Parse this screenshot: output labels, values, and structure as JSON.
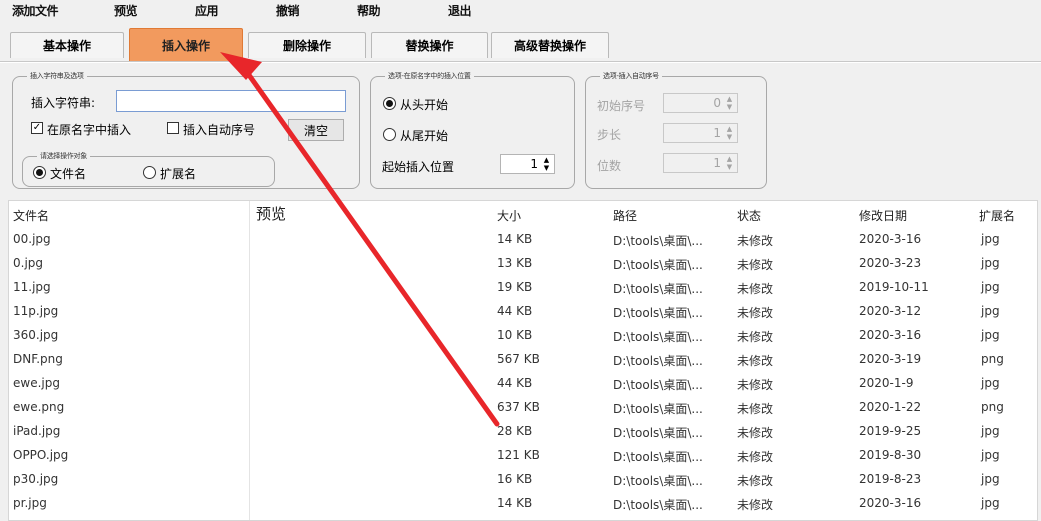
{
  "menu": [
    "添加文件",
    "预览",
    "应用",
    "撤销",
    "帮助",
    "退出"
  ],
  "tabs": [
    {
      "label": "基本操作",
      "active": false
    },
    {
      "label": "插入操作",
      "active": true
    },
    {
      "label": "删除操作",
      "active": false
    },
    {
      "label": "替换操作",
      "active": false
    },
    {
      "label": "高级替换操作",
      "active": false
    }
  ],
  "insert_group": {
    "legend": "插入字符串及选项",
    "string_label": "插入字符串:",
    "string_value": "",
    "in_original_label": "在原名字中插入",
    "in_original_checked": true,
    "auto_number_label": "插入自动序号",
    "auto_number_checked": false,
    "clear_label": "清空"
  },
  "target_group": {
    "legend": "请选择操作对象",
    "filename_label": "文件名",
    "filename_selected": true,
    "extension_label": "扩展名",
    "extension_selected": false
  },
  "position_group": {
    "legend": "选项-在原名字中的插入位置",
    "from_start_label": "从头开始",
    "from_start_selected": true,
    "from_end_label": "从尾开始",
    "from_end_selected": false,
    "start_pos_label": "起始插入位置",
    "start_pos_value": "1"
  },
  "number_group": {
    "legend": "选项-插入自动序号",
    "initial_label": "初始序号",
    "initial_value": "0",
    "step_label": "步长",
    "step_value": "1",
    "digits_label": "位数",
    "digits_value": "1"
  },
  "table": {
    "headers": [
      "文件名",
      "预览",
      "大小",
      "路径",
      "状态",
      "修改日期",
      "扩展名"
    ],
    "rows": [
      [
        "00.jpg",
        "",
        "14 KB",
        "D:\\tools\\桌面\\...",
        "未修改",
        "2020-3-16",
        "jpg"
      ],
      [
        "0.jpg",
        "",
        "13 KB",
        "D:\\tools\\桌面\\...",
        "未修改",
        "2020-3-23",
        "jpg"
      ],
      [
        "11.jpg",
        "",
        "19 KB",
        "D:\\tools\\桌面\\...",
        "未修改",
        "2019-10-11",
        "jpg"
      ],
      [
        "11p.jpg",
        "",
        "44 KB",
        "D:\\tools\\桌面\\...",
        "未修改",
        "2020-3-12",
        "jpg"
      ],
      [
        "360.jpg",
        "",
        "10 KB",
        "D:\\tools\\桌面\\...",
        "未修改",
        "2020-3-16",
        "jpg"
      ],
      [
        "DNF.png",
        "",
        "567 KB",
        "D:\\tools\\桌面\\...",
        "未修改",
        "2020-3-19",
        "png"
      ],
      [
        "ewe.jpg",
        "",
        "44 KB",
        "D:\\tools\\桌面\\...",
        "未修改",
        "2020-1-9",
        "jpg"
      ],
      [
        "ewe.png",
        "",
        "637 KB",
        "D:\\tools\\桌面\\...",
        "未修改",
        "2020-1-22",
        "png"
      ],
      [
        "iPad.jpg",
        "",
        "28 KB",
        "D:\\tools\\桌面\\...",
        "未修改",
        "2019-9-25",
        "jpg"
      ],
      [
        "OPPO.jpg",
        "",
        "121 KB",
        "D:\\tools\\桌面\\...",
        "未修改",
        "2019-8-30",
        "jpg"
      ],
      [
        "p30.jpg",
        "",
        "16 KB",
        "D:\\tools\\桌面\\...",
        "未修改",
        "2019-8-23",
        "jpg"
      ],
      [
        "pr.jpg",
        "",
        "14 KB",
        "D:\\tools\\桌面\\...",
        "未修改",
        "2020-3-16",
        "jpg"
      ]
    ]
  },
  "colors": {
    "active_tab": "#f29a5e",
    "annotation_arrow": "#e8262a"
  }
}
